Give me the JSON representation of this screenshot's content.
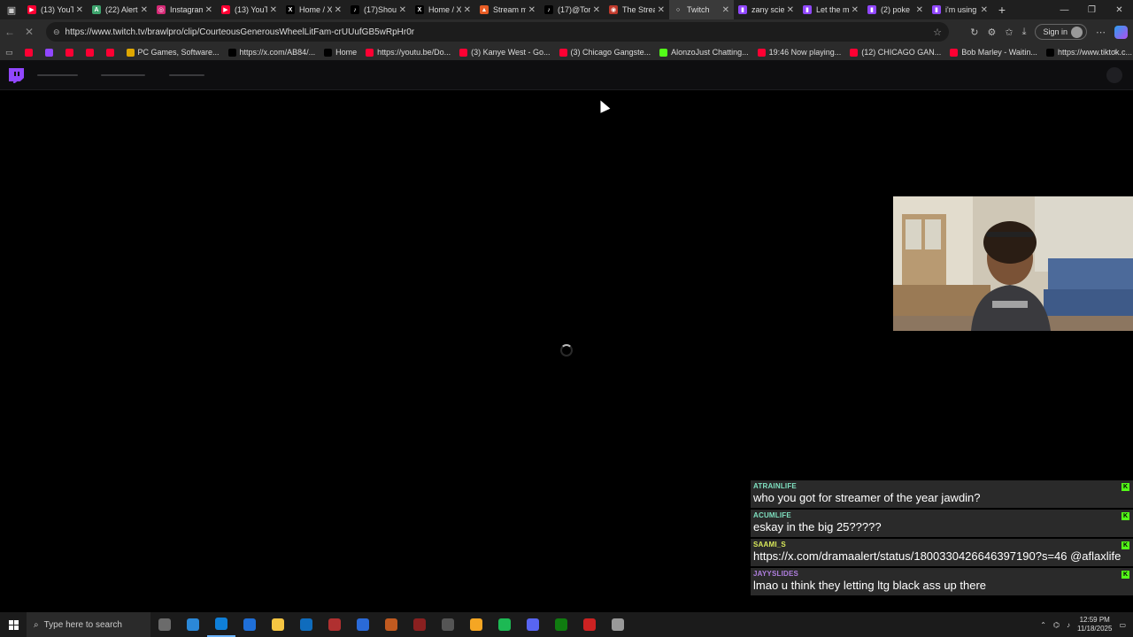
{
  "browser": {
    "tabs": [
      {
        "title": "(13) YouT",
        "color": "#ff0033",
        "glyph": "▶"
      },
      {
        "title": "(22) Alert",
        "color": "#3ea56e",
        "glyph": "A"
      },
      {
        "title": "Instagram",
        "color": "#d62976",
        "glyph": "◎"
      },
      {
        "title": "(13) YouT",
        "color": "#ff0033",
        "glyph": "▶"
      },
      {
        "title": "Home / X",
        "color": "#000000",
        "glyph": "X"
      },
      {
        "title": "(17)Shou",
        "color": "#000000",
        "glyph": "♪"
      },
      {
        "title": "Home / X",
        "color": "#000000",
        "glyph": "X"
      },
      {
        "title": "Stream m",
        "color": "#e85d25",
        "glyph": "▲"
      },
      {
        "title": "(17)@Tor",
        "color": "#000000",
        "glyph": "♪"
      },
      {
        "title": "The Strea",
        "color": "#c0392b",
        "glyph": "◉"
      },
      {
        "title": "Twitch",
        "color": "#3a3a3a",
        "glyph": "○",
        "active": true
      },
      {
        "title": "zany scie",
        "color": "#9147ff",
        "glyph": "▮"
      },
      {
        "title": "Let the m",
        "color": "#9147ff",
        "glyph": "▮"
      },
      {
        "title": "(2) poke",
        "color": "#9147ff",
        "glyph": "▮"
      },
      {
        "title": "i'm using",
        "color": "#9147ff",
        "glyph": "▮"
      }
    ],
    "url": "https://www.twitch.tv/brawlpro/clip/CourteousGenerousWheelLitFam-crUUufGB5wRpHr0r",
    "signin_label": "Sign in",
    "bookmarks": [
      {
        "label": "",
        "color": "#ff0033"
      },
      {
        "label": "",
        "color": "#9147ff"
      },
      {
        "label": "",
        "color": "#ff0033"
      },
      {
        "label": "",
        "color": "#ff0033"
      },
      {
        "label": "",
        "color": "#ff0033"
      },
      {
        "label": "PC Games, Software...",
        "color": "#e0a800"
      },
      {
        "label": "https://x.com/AB84/...",
        "color": "#000000"
      },
      {
        "label": "Home",
        "color": "#000000"
      },
      {
        "label": "https://youtu.be/Do...",
        "color": "#ff0033"
      },
      {
        "label": "(3) Kanye West - Go...",
        "color": "#ff0033"
      },
      {
        "label": "(3) Chicago Gangste...",
        "color": "#ff0033"
      },
      {
        "label": "AlonzoJust Chatting...",
        "color": "#53fc18"
      },
      {
        "label": "19:46 Now playing...",
        "color": "#ff0033"
      },
      {
        "label": "(12) CHICAGO GAN...",
        "color": "#ff0033"
      },
      {
        "label": "Bob Marley - Waitin...",
        "color": "#ff0033"
      },
      {
        "label": "https://www.tiktok.c...",
        "color": "#000000"
      }
    ]
  },
  "chat": {
    "messages": [
      {
        "user": "ATRAINLIFE",
        "user_color": "#7fe0c0",
        "text": "who you got for streamer of the year jawdin?"
      },
      {
        "user": "ACUMLIFE",
        "user_color": "#7fe0c0",
        "text": "eskay in the big 25?????"
      },
      {
        "user": "SAAMI_S",
        "user_color": "#d8e85a",
        "text": "https://x.com/dramaalert/status/1800330426646397190?s=46 @aflaxlife"
      },
      {
        "user": "JAYYSLIDES",
        "user_color": "#b07fe0",
        "text": "lmao u think they letting ltg black ass up there"
      }
    ]
  },
  "taskbar": {
    "search_placeholder": "Type here to search",
    "time": "12:59 PM",
    "date": "11/18/2025",
    "apps": [
      {
        "color": "#6b6b6b"
      },
      {
        "color": "#2b88d8"
      },
      {
        "color": "#0f7fd8",
        "active": true
      },
      {
        "color": "#1f6fd8"
      },
      {
        "color": "#f5c542"
      },
      {
        "color": "#0f6cbd"
      },
      {
        "color": "#b03030"
      },
      {
        "color": "#2a6ad8"
      },
      {
        "color": "#c05a20"
      },
      {
        "color": "#8a2020"
      },
      {
        "color": "#555555"
      },
      {
        "color": "#f5a623"
      },
      {
        "color": "#1db954"
      },
      {
        "color": "#5865f2"
      },
      {
        "color": "#107c10"
      },
      {
        "color": "#cc2222"
      },
      {
        "color": "#999999"
      }
    ]
  }
}
